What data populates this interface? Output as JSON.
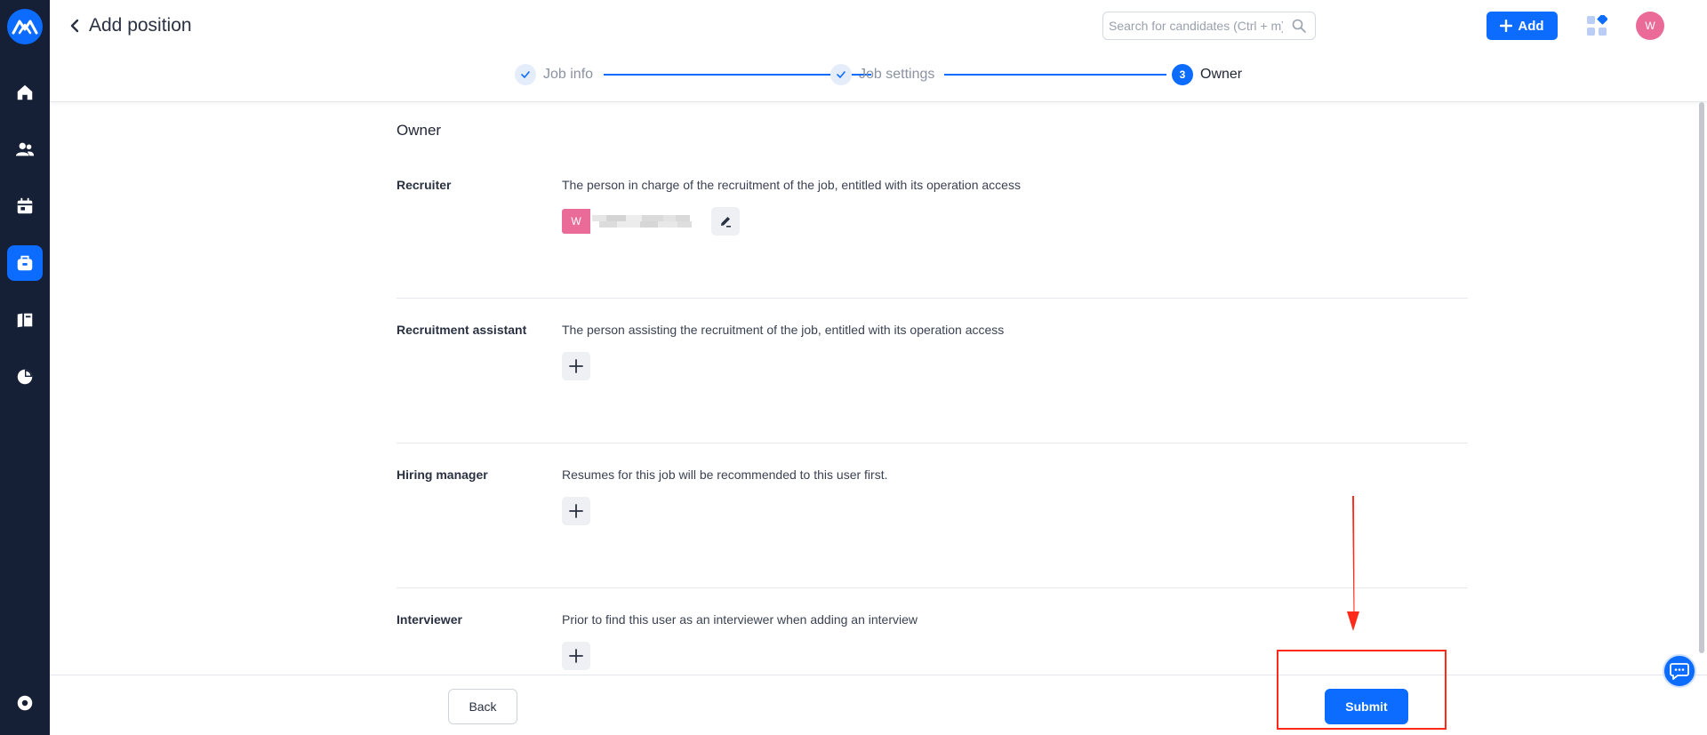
{
  "header": {
    "title": "Add position",
    "search_placeholder": "Search for candidates (Ctrl + m)",
    "add_label": "Add",
    "avatar_initial": "W"
  },
  "stepper": {
    "steps": [
      {
        "label": "Job info",
        "state": "done"
      },
      {
        "label": "Job settings",
        "state": "done"
      },
      {
        "label": "Owner",
        "state": "current",
        "number": "3"
      }
    ]
  },
  "sidebar": {
    "items": [
      {
        "icon": "home-icon"
      },
      {
        "icon": "people-icon"
      },
      {
        "icon": "calendar-icon"
      },
      {
        "icon": "briefcase-icon",
        "active": true
      },
      {
        "icon": "talent-pool-icon"
      },
      {
        "icon": "pie-chart-icon"
      },
      {
        "icon": "settings-icon"
      }
    ]
  },
  "owner": {
    "section_title": "Owner",
    "rows": [
      {
        "label": "Recruiter",
        "description": "The person in charge of the recruitment of the job, entitled with its operation access",
        "assigned_initial": "W"
      },
      {
        "label": "Recruitment assistant",
        "description": "The person assisting the recruitment of the job, entitled with its operation access"
      },
      {
        "label": "Hiring manager",
        "description": "Resumes for this job will be recommended to this user first."
      },
      {
        "label": "Interviewer",
        "description": "Prior to find this user as an interviewer when adding an interview"
      }
    ]
  },
  "footer": {
    "back_label": "Back",
    "submit_label": "Submit"
  },
  "colors": {
    "sidebar_bg": "#152036",
    "accent": "#0b6cff",
    "avatar_pink": "#ea6b97",
    "annotation_red": "#ff2a1a"
  }
}
